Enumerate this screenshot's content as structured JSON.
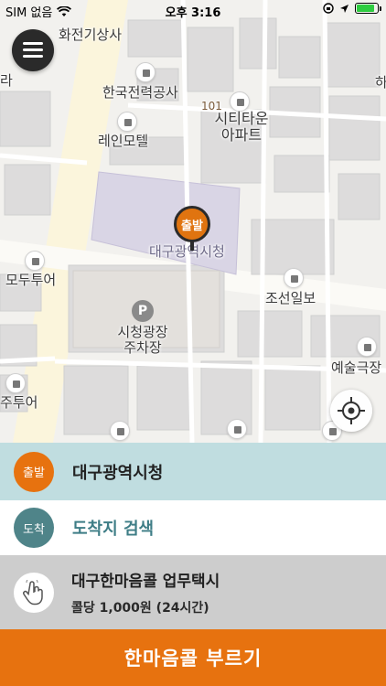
{
  "status_bar": {
    "carrier": "SIM 없음",
    "time": "오후 3:16",
    "battery_level": 0.85,
    "icons": [
      "wifi-icon",
      "lock-rotation-icon",
      "location-arrow-icon",
      "battery-icon"
    ]
  },
  "map": {
    "labels": {
      "electric_shop": "화전기상사",
      "kepco": "한국전력공사",
      "building_number": "101",
      "city_town_1": "시티타운",
      "city_town_2": "아파트",
      "rain_motel": "레인모텔",
      "city_hall": "대구광역시청",
      "modu_tour": "모두투어",
      "parking_1": "시청광장",
      "parking_2": "주차장",
      "chosun": "조선일보",
      "art_theater": "예술극장",
      "tour_edge": "주투어",
      "left_edge": "라",
      "right_edge": "하"
    },
    "parking_symbol": "P",
    "start_pin_label": "출발"
  },
  "panel": {
    "start": {
      "badge": "출발",
      "text": "대구광역시청"
    },
    "destination": {
      "badge": "도착",
      "text": "도착지 검색"
    },
    "taxi": {
      "name": "대구한마음콜 업무택시",
      "price": "콜당 1,000원 (24시간)"
    }
  },
  "call_button": {
    "label": "한마음콜 부르기"
  },
  "colors": {
    "accent": "#e7720f",
    "start_row": "#c0dde0",
    "dest_accent": "#4f8489",
    "taxi_row": "#cdcdcd"
  }
}
